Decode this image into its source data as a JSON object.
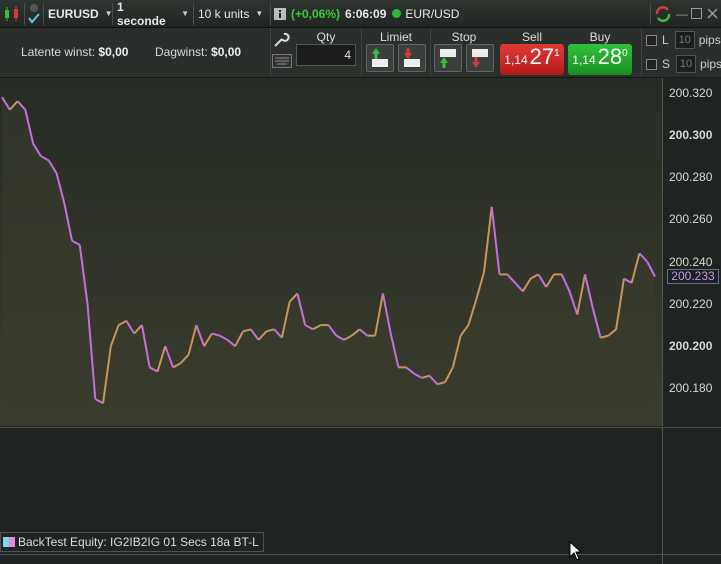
{
  "toolbar": {
    "symbol": "EURUSD",
    "timeframe": "1 seconde",
    "units": "10 k units",
    "change": "(+0,06%)",
    "time": "6:06:09",
    "instrument": "EUR/USD"
  },
  "account": {
    "latent_label": "Latente winst:",
    "latent_value": "$0,00",
    "day_label": "Dagwinst:",
    "day_value": "$0,00"
  },
  "order": {
    "qty_label": "Qty",
    "qty_value": "4",
    "limit_label": "Limiet",
    "stop_label": "Stop",
    "sell_label": "Sell",
    "buy_label": "Buy",
    "sell_prefix": "1,14",
    "sell_big": "27",
    "sell_sup": "1",
    "buy_prefix": "1,14",
    "buy_big": "28",
    "buy_sup": "0",
    "l_label": "L",
    "s_label": "S",
    "pips_value": "10",
    "pips_label": "pips"
  },
  "chart_data": {
    "type": "line",
    "yticks": [
      "200.320",
      "200.300",
      "200.280",
      "200.260",
      "200.240",
      "200.220",
      "200.200",
      "200.180"
    ],
    "bold_ticks": [
      "200.300",
      "200.200"
    ],
    "current_value": "200.233",
    "ylim": [
      200.166,
      200.327
    ],
    "values": [
      200.318,
      200.312,
      200.316,
      200.312,
      200.296,
      200.29,
      200.288,
      200.282,
      200.268,
      200.25,
      200.248,
      200.22,
      200.175,
      200.173,
      200.2,
      200.21,
      200.212,
      200.206,
      200.21,
      200.19,
      200.188,
      200.2,
      200.19,
      200.192,
      200.196,
      200.21,
      200.2,
      200.206,
      200.205,
      200.203,
      200.2,
      200.207,
      200.208,
      200.203,
      200.207,
      200.208,
      200.204,
      200.221,
      200.225,
      200.21,
      200.208,
      200.21,
      200.21,
      200.205,
      200.203,
      200.205,
      200.208,
      200.205,
      200.205,
      200.225,
      200.206,
      200.19,
      200.19,
      200.187,
      200.185,
      200.186,
      200.182,
      200.183,
      200.19,
      200.205,
      200.21,
      200.222,
      200.235,
      200.266,
      200.234,
      200.234,
      200.23,
      200.226,
      200.232,
      200.234,
      200.228,
      200.234,
      200.234,
      200.226,
      200.215,
      200.234,
      200.218,
      200.204,
      200.205,
      200.208,
      200.232,
      200.23,
      200.244,
      200.24,
      200.233
    ],
    "series_colors": {
      "down": "#c46fe0",
      "up": "#c8955a"
    },
    "fill_color": "#3a3d2e",
    "legend": "BackTest Equity: IG2IB2IG 01 Secs 18a BT-L"
  }
}
